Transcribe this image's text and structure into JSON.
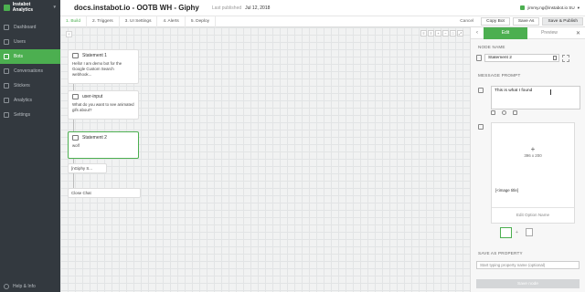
{
  "sidebar": {
    "brand": "Instabot Analytics",
    "items": [
      {
        "label": "Dashboard"
      },
      {
        "label": "Users"
      },
      {
        "label": "Bots"
      },
      {
        "label": "Conversations"
      },
      {
        "label": "Stickers"
      },
      {
        "label": "Analytics"
      },
      {
        "label": "Settings"
      }
    ],
    "help": "Help & Info"
  },
  "header": {
    "title": "docs.instabot.io - OOTB WH - Giphy",
    "published_label": "Last published",
    "published_date": "Jul 12, 2018",
    "user": "jimmy.ng@instabot.io SU"
  },
  "steps": [
    "1. Build",
    "2. Triggers",
    "3. UI Settings",
    "4. Alerts",
    "5. Deploy"
  ],
  "actions": {
    "cancel": "Cancel",
    "copy": "Copy Bot",
    "save_as": "Save As",
    "save_publish": "Save & Publish"
  },
  "canvas": {
    "nodes": [
      {
        "title": "Statement 1",
        "body": "Hello! I am demo bot for the Google Custom Search webhook..."
      },
      {
        "title": "user-input",
        "body": "What do you want to see animated gifs about?"
      },
      {
        "title": "Statement 2",
        "body": "wolf"
      }
    ],
    "chips": [
      "[nGiphy S...",
      "Close Chat"
    ]
  },
  "panel": {
    "tab_edit": "Edit",
    "tab_preview": "Preview",
    "node_name_label": "NODE NAME",
    "node_name_value": "Statement 2",
    "message_prompt_label": "MESSAGE PROMPT",
    "message_text": "This is what I found",
    "image_size": "396 x 200",
    "image_tag": "[<image title]",
    "edit_option": "Edit Option Name",
    "save_as_property_label": "SAVE AS PROPERTY",
    "property_placeholder": "Start typing property name (optional)",
    "save_button": "Save node"
  }
}
